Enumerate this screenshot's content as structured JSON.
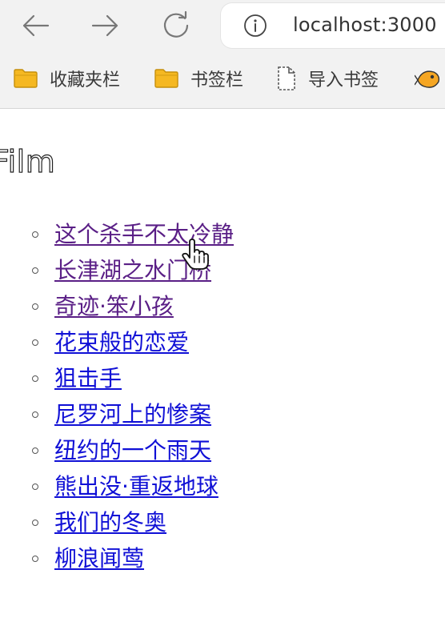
{
  "browser": {
    "url": "localhost:3000",
    "bookmarks": [
      {
        "label": "收藏夹栏",
        "icon": "folder-icon"
      },
      {
        "label": "书签栏",
        "icon": "folder-icon"
      },
      {
        "label": "导入书签",
        "icon": "document-icon"
      },
      {
        "label": "",
        "icon": "fish-logo-icon"
      }
    ]
  },
  "page": {
    "title": "Film",
    "films": [
      {
        "label": "这个杀手不太冷静",
        "visited": true
      },
      {
        "label": "长津湖之水门桥",
        "visited": true
      },
      {
        "label": "奇迹·笨小孩",
        "visited": true
      },
      {
        "label": "花束般的恋爱",
        "visited": false
      },
      {
        "label": "狙击手",
        "visited": false
      },
      {
        "label": "尼罗河上的惨案",
        "visited": false
      },
      {
        "label": "纽约的一个雨天",
        "visited": false
      },
      {
        "label": "熊出没·重返地球",
        "visited": false
      },
      {
        "label": "我们的冬奥",
        "visited": false
      },
      {
        "label": "柳浪闻莺",
        "visited": false
      }
    ]
  },
  "colors": {
    "link": "#1010d6",
    "visited_link": "#5a1f86",
    "folder": "#f5b822"
  }
}
